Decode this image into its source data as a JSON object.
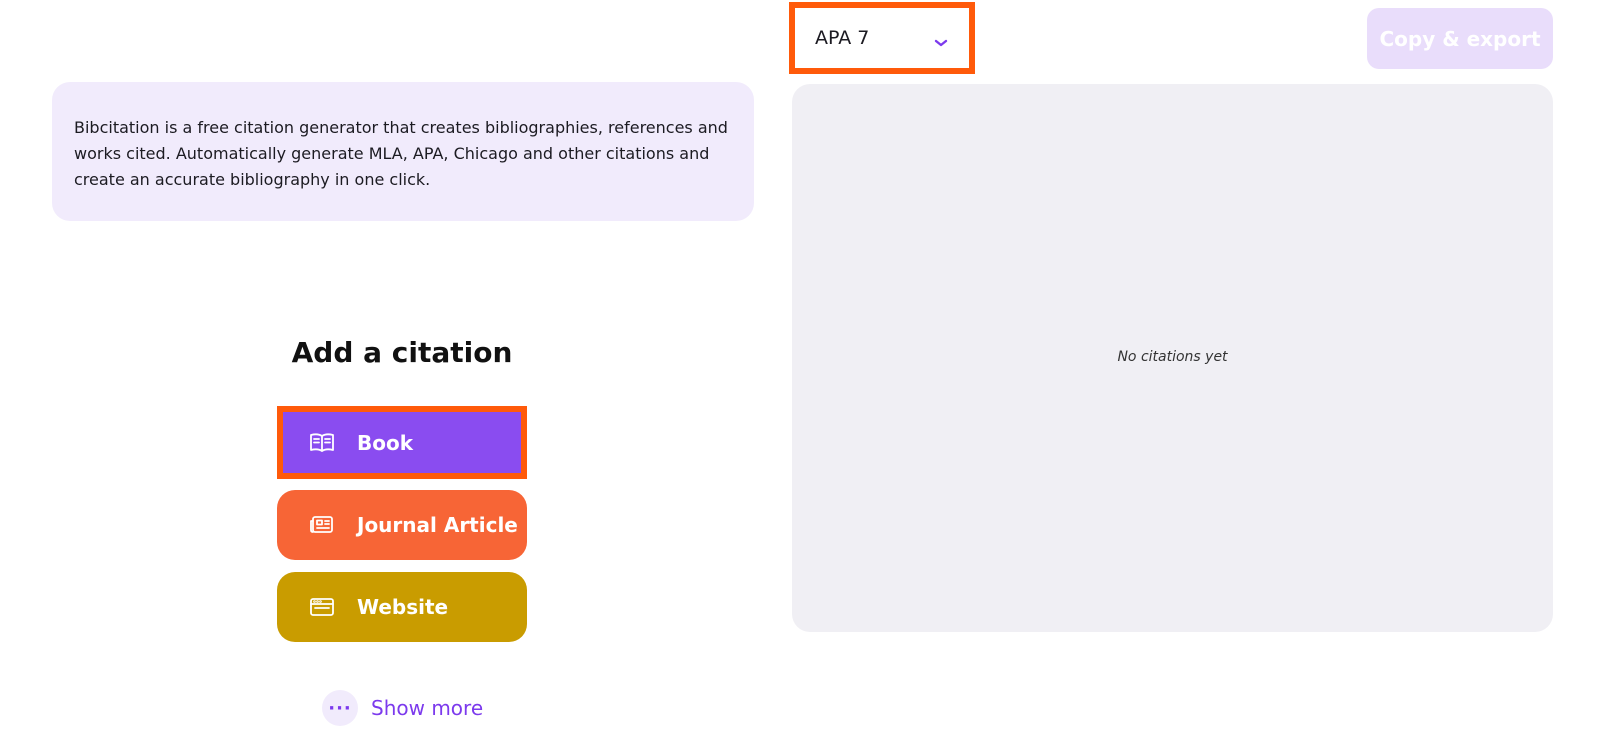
{
  "intro": {
    "text": "Bibcitation is a free citation generator that creates bibliographies, references and works cited. Automatically generate MLA, APA, Chicago and other citations and create an accurate bibliography in one click."
  },
  "add_citation": {
    "title": "Add a citation",
    "buttons": [
      {
        "label": "Book",
        "icon": "book-icon",
        "color": "#8a4cf0"
      },
      {
        "label": "Journal Article",
        "icon": "newspaper-icon",
        "color": "#f76536"
      },
      {
        "label": "Website",
        "icon": "browser-window-icon",
        "color": "#c99c00"
      }
    ],
    "show_more": {
      "label": "Show more",
      "icon": "ellipsis-icon",
      "glyph": "···"
    }
  },
  "style_select": {
    "value": "APA 7",
    "icon": "chevron-down-icon"
  },
  "toolbar": {
    "export_label": "Copy & export"
  },
  "citations": {
    "empty_text": "No citations yet"
  },
  "colors": {
    "accent": "#7c3aed",
    "highlight_border": "#ff5a0a",
    "intro_bg": "#f1ebfc",
    "panel_bg": "#f0eff4",
    "export_bg": "#e9ddfb"
  }
}
